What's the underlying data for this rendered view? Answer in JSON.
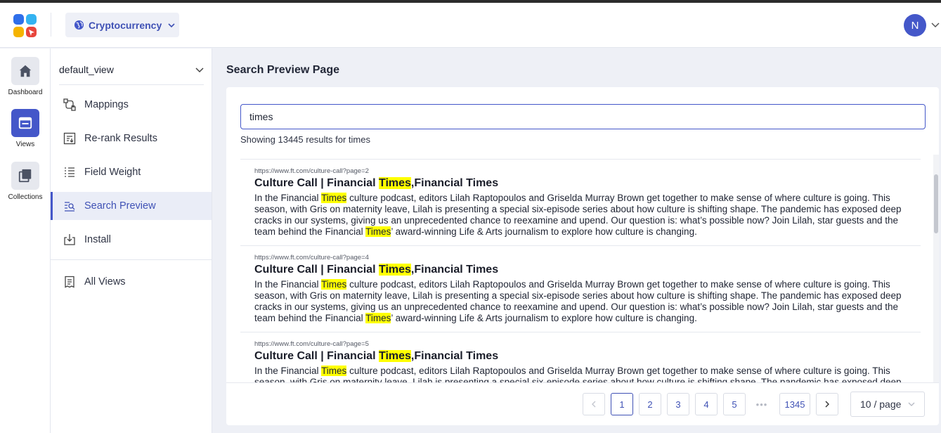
{
  "header": {
    "project": "Cryptocurrency",
    "user_initial": "N"
  },
  "rail": [
    {
      "label": "Dashboard",
      "icon": "home-icon"
    },
    {
      "label": "Views",
      "icon": "views-icon"
    },
    {
      "label": "Collections",
      "icon": "collections-icon"
    }
  ],
  "subnav": {
    "view": "default_view",
    "items": [
      {
        "label": "Mappings",
        "icon": "mappings-icon"
      },
      {
        "label": "Re-rank Results",
        "icon": "rerank-icon"
      },
      {
        "label": "Field Weight",
        "icon": "field-weight-icon"
      },
      {
        "label": "Search Preview",
        "icon": "search-preview-icon"
      },
      {
        "label": "Install",
        "icon": "install-icon"
      }
    ],
    "all_views": "All Views"
  },
  "page": {
    "title": "Search Preview Page",
    "query": "times",
    "results_count": "Showing 13445 results for times"
  },
  "results": [
    {
      "url": "https://www.ft.com/culture-call?page=2",
      "title_a": "Culture Call | Financial ",
      "title_hl": "Times",
      "title_b": ",Financial Times",
      "p1": "In the Financial ",
      "hl1": "Times",
      "p2": " culture podcast, editors Lilah Raptopoulos and Griselda Murray Brown get together to make sense of where culture is going. This season, with Gris on maternity leave, Lilah is presenting a special six-episode series about how culture is shifting shape. The pandemic has exposed deep cracks in our systems, giving us an unprecedented chance to reexamine and upend. Our question is: what’s possible now? Join Lilah, star guests and the team behind the Financial ",
      "hl2": "Times",
      "p3": "’ award-winning Life & Arts journalism to explore how culture is changing."
    },
    {
      "url": "https://www.ft.com/culture-call?page=4",
      "title_a": "Culture Call | Financial ",
      "title_hl": "Times",
      "title_b": ",Financial Times",
      "p1": "In the Financial ",
      "hl1": "Times",
      "p2": " culture podcast, editors Lilah Raptopoulos and Griselda Murray Brown get together to make sense of where culture is going. This season, with Gris on maternity leave, Lilah is presenting a special six-episode series about how culture is shifting shape. The pandemic has exposed deep cracks in our systems, giving us an unprecedented chance to reexamine and upend. Our question is: what’s possible now? Join Lilah, star guests and the team behind the Financial ",
      "hl2": "Times",
      "p3": "’ award-winning Life & Arts journalism to explore how culture is changing."
    },
    {
      "url": "https://www.ft.com/culture-call?page=5",
      "title_a": "Culture Call | Financial ",
      "title_hl": "Times",
      "title_b": ",Financial Times",
      "p1": "In the Financial ",
      "hl1": "Times",
      "p2": " culture podcast, editors Lilah Raptopoulos and Griselda Murray Brown get together to make sense of where culture is going. This season, with Gris on maternity leave, Lilah is presenting a special six-episode series about how culture is shifting shape. The pandemic has exposed deep cracks in our systems, giving us an unprecedented chance to reexamine and upend.",
      "hl2": "",
      "p3": ""
    }
  ],
  "pagination": {
    "pages": [
      "1",
      "2",
      "3",
      "4",
      "5"
    ],
    "ellipsis": "•••",
    "last": "1345",
    "page_size": "10 / page"
  },
  "colors": {
    "accent": "#4457c9",
    "highlight": "#ffff00"
  }
}
